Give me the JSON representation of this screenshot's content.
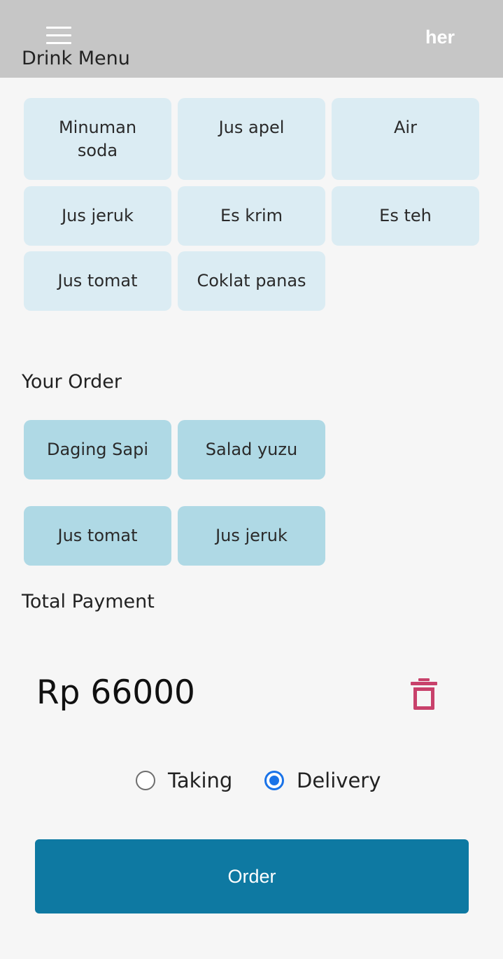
{
  "header": {
    "title": "Drink Menu",
    "brand": "her",
    "menu_icon": "hamburger-menu-icon",
    "background": "#c6c6c6"
  },
  "drinks": [
    {
      "label": "Minuman\nsoda"
    },
    {
      "label": "Jus apel"
    },
    {
      "label": "Air"
    },
    {
      "label": "Jus jeruk"
    },
    {
      "label": "Es krim"
    },
    {
      "label": "Es teh"
    },
    {
      "label": "Jus tomat"
    },
    {
      "label": "Coklat panas"
    }
  ],
  "your_order": {
    "label": "Your Order",
    "items": [
      {
        "label": "Daging Sapi"
      },
      {
        "label": "Salad yuzu"
      },
      {
        "label": "Jus tomat"
      },
      {
        "label": "Jus jeruk"
      }
    ]
  },
  "payment": {
    "label": "Total Payment",
    "amount": "Rp 66000",
    "delete_icon": "trash-icon",
    "delete_color": "#c8416b"
  },
  "delivery_options": {
    "taking": {
      "label": "Taking",
      "selected": false
    },
    "delivery": {
      "label": "Delivery",
      "selected": true
    },
    "accent": "#1a73e8"
  },
  "order_button": {
    "label": "Order",
    "color": "#0e79a2"
  }
}
